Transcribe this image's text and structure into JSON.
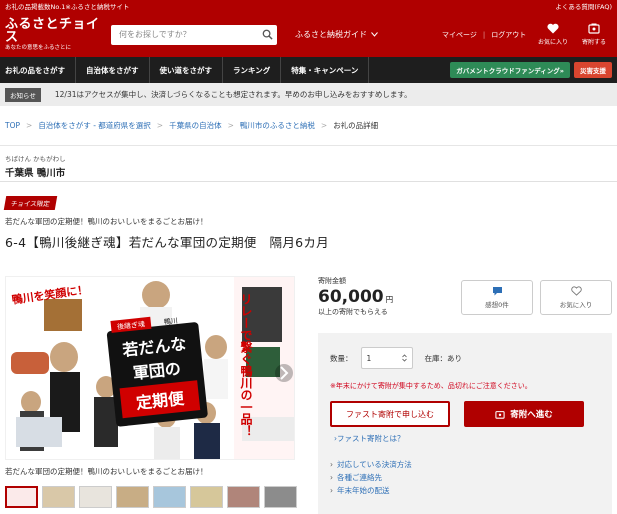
{
  "topstrip": {
    "left": "お礼の品掲載数No.1※ふるさと納税サイト",
    "right": "よくある質問(FAQ)"
  },
  "header": {
    "logo": "ふるさとチョイス",
    "tagline": "あなたの意思をふるさとに",
    "search_placeholder": "何をお探しですか？",
    "guide": "ふるさと納税ガイド",
    "mypage": "マイページ",
    "logout": "ログアウト",
    "favorites": "お気に入り",
    "cart": "寄附する"
  },
  "nav": {
    "items": [
      "お礼の品をさがす",
      "自治体をさがす",
      "使い道をさがす",
      "ランキング",
      "特集・キャンペーン"
    ],
    "gov": "ガバメントクラウドファンディング»",
    "disaster": "災害支援"
  },
  "notice": {
    "badge": "お知らせ",
    "text": "12/31はアクセスが集中し、決済しづらくなることも想定されます。早めのお申し込みをおすすめします。"
  },
  "breadcrumb": [
    "TOP",
    "自治体をさがす - 都道府県を選択",
    "千葉県の自治体",
    "鴨川市のふるさと納税",
    "お礼の品詳細"
  ],
  "municipality": {
    "kana": "ちばけん かもがわし",
    "name": "千葉県 鴨川市"
  },
  "product": {
    "badge": "チョイス限定",
    "catch": "若だんな軍団の定期便！鴨川のおいしいをまるごとお届け！",
    "title": "6-4【鴨川後継ぎ魂】若だんな軍団の定期便　隔月6カ月",
    "image_texts": {
      "left": "鴨川を笑顔に！",
      "right": "リレーで繋ぐ鴨川の一品！",
      "tag1": "後継ぎ魂",
      "tag2": "鴨川",
      "center1": "若だんな",
      "center2": "軍団の",
      "center3": "定期便"
    },
    "caption": "若だんな軍団の定期便！鴨川のおいしいをまるごとお届け！"
  },
  "donation": {
    "label": "寄附金額",
    "amount": "60,000",
    "unit": "円",
    "sub": "以上の寄附でもらえる",
    "comment_label": "感想0件",
    "fav_label": "お気に入り"
  },
  "panel": {
    "qty_label": "数量：",
    "qty_value": "1",
    "stock": "在庫：あり",
    "warning": "※年末にかけて寄附が集中するため、品切れにご注意ください。",
    "fast_btn": "ファスト寄附で申し込む",
    "donate_btn": "寄附へ進む",
    "fast_what": "ファスト寄附とは？",
    "links": [
      "対応している決済方法",
      "各種ご連絡先",
      "年末年始の配送"
    ]
  },
  "colors": {
    "brand": "#b00000",
    "link": "#2d6fb6",
    "warning": "#d0021b"
  }
}
